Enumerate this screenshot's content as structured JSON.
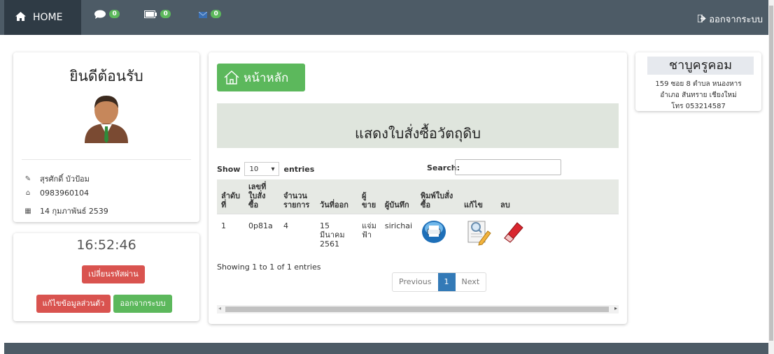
{
  "nav": {
    "home_label": "HOME",
    "messages_count": "0",
    "tasks_count": "0",
    "alerts_count": "0",
    "logout_label": "ออกจากระบบ"
  },
  "profile": {
    "welcome": "ยินดีต้อนรับ",
    "name": "สุรศักดิ์ บัวป้อม",
    "phone": "0983960104",
    "birthdate": "14 กุมภาพันธ์ 2539",
    "clock": "16:52:46",
    "change_password_label": "เปลี่ยนรหัสผ่าน",
    "edit_profile_label": "แก้ไขข้อมูลส่วนตัว",
    "logout_label": "ออกจากระบบ"
  },
  "main": {
    "home_button_label": "หน้าหลัก",
    "heading": "แสดงใบสั่งซื้อวัตถุดิบ",
    "show_label": "Show",
    "entries_value": "10",
    "entries_label": "entries",
    "search_label": "Search:",
    "search_value": "",
    "columns": [
      "ลำดับที่",
      "เลขที่ใบสั่งซื้อ",
      "จำนวนรายการ",
      "วันที่ออก",
      "ผู้ขาย",
      "ผู้บันทึก",
      "พิมพ์ใบสั่งซื้อ",
      "แก้ไข",
      "ลบ"
    ],
    "rows": [
      {
        "no": "1",
        "order_no": "0p81a",
        "items": "4",
        "date": "15 มีนาคม 2561",
        "seller": "แจ่มฟ้า",
        "recorder": "sirichai"
      }
    ],
    "showing_text": "Showing 1 to 1 of 1 entries",
    "pager": {
      "previous": "Previous",
      "current": "1",
      "next": "Next"
    }
  },
  "shop": {
    "name": "ชาบูครูคอม",
    "address1": "159 ซอย 8 ตำบล หนองหาร",
    "address2": "อำเภอ สันทราย เชียงใหม่",
    "phone_line": "โทร 053214587"
  },
  "colors": {
    "navbar": "#4d5b66",
    "nav_active": "#2f3b45",
    "success": "#5cb85c",
    "danger": "#d9534f",
    "primary": "#337ab7",
    "heading_band": "#dfe5dd"
  }
}
